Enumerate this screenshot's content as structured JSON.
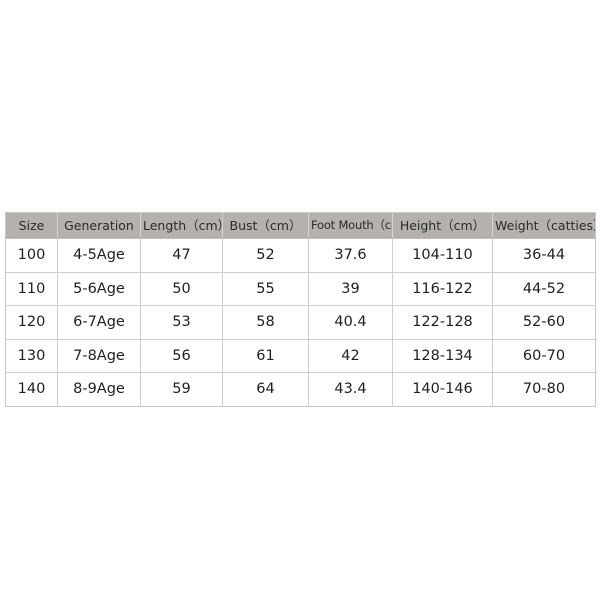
{
  "table": {
    "columns": [
      {
        "key": "size",
        "label": "Size",
        "tight": false
      },
      {
        "key": "generation",
        "label": "Generation",
        "tight": false
      },
      {
        "key": "length",
        "label": "Length（cm）",
        "tight": false
      },
      {
        "key": "bust",
        "label": "Bust（cm）",
        "tight": false
      },
      {
        "key": "foot_mouth",
        "label": "Foot Mouth（cm）",
        "tight": true
      },
      {
        "key": "height",
        "label": "Height（cm）",
        "tight": false
      },
      {
        "key": "weight",
        "label": "Weight（catties）",
        "tight": false
      }
    ],
    "rows": [
      {
        "size": "100",
        "generation": "4-5Age",
        "length": "47",
        "bust": "52",
        "foot_mouth": "37.6",
        "height": "104-110",
        "weight": "36-44"
      },
      {
        "size": "110",
        "generation": "5-6Age",
        "length": "50",
        "bust": "55",
        "foot_mouth": "39",
        "height": "116-122",
        "weight": "44-52"
      },
      {
        "size": "120",
        "generation": "6-7Age",
        "length": "53",
        "bust": "58",
        "foot_mouth": "40.4",
        "height": "122-128",
        "weight": "52-60"
      },
      {
        "size": "130",
        "generation": "7-8Age",
        "length": "56",
        "bust": "61",
        "foot_mouth": "42",
        "height": "128-134",
        "weight": "60-70"
      },
      {
        "size": "140",
        "generation": "8-9Age",
        "length": "59",
        "bust": "64",
        "foot_mouth": "43.4",
        "height": "140-146",
        "weight": "70-80"
      }
    ]
  },
  "colors": {
    "page_background": "#ffffff",
    "header_background": "#b5b2ad",
    "header_text": "#2b2b2b",
    "cell_text": "#1f1f1f",
    "border": "#cfcdc9"
  }
}
